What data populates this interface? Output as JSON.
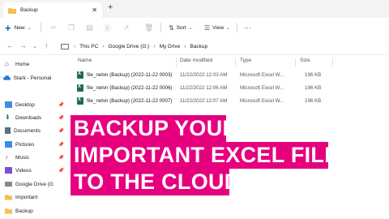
{
  "tab": {
    "title": "Backup",
    "close": "✕",
    "new_tab": "+"
  },
  "toolbar": {
    "new_label": "New",
    "sort_label": "Sort",
    "view_label": "View",
    "more": "···"
  },
  "address": {
    "crumbs": [
      "This PC",
      "Google Drive (G:)",
      "My Drive",
      "Backup"
    ]
  },
  "sidebar": {
    "items": [
      {
        "label": "Home"
      },
      {
        "label": "Stark - Personal"
      },
      {
        "label": "Desktop"
      },
      {
        "label": "Downloads"
      },
      {
        "label": "Documents"
      },
      {
        "label": "Pictures"
      },
      {
        "label": "Music"
      },
      {
        "label": "Videos"
      },
      {
        "label": "Google Drive (G"
      },
      {
        "label": "Important"
      },
      {
        "label": "Backup"
      }
    ]
  },
  "table": {
    "headers": {
      "name": "Name",
      "date": "Date modified",
      "type": "Type",
      "size": "Size"
    },
    "rows": [
      {
        "name": "file_netvn (Backup) (2022-11-22 0003)",
        "date": "11/22/2022 12:03 AM",
        "type": "Microsoft Excel W...",
        "size": "196 KB"
      },
      {
        "name": "file_netvn (Backup) (2022-11-22 0006)",
        "date": "11/22/2022 12:06 AM",
        "type": "Microsoft Excel W...",
        "size": "196 KB"
      },
      {
        "name": "file_netvn (Backup) (2022-11-22 0007)",
        "date": "11/22/2022 12:07 AM",
        "type": "Microsoft Excel W...",
        "size": "196 KB"
      }
    ]
  },
  "banner": {
    "line1": "BACKUP YOUR",
    "line2": "IMPORTANT EXCEL FILE",
    "line3": "TO THE CLOUD"
  },
  "colors": {
    "banner": "#e6007e",
    "accent": "#0067c0",
    "folder": "#f4c04e",
    "excel": "#1d6f42"
  }
}
